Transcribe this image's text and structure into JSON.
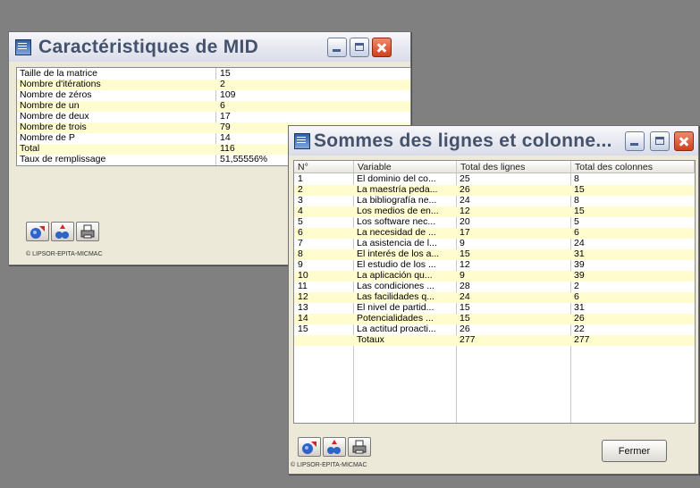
{
  "window1": {
    "title": "Caractéristiques de MID",
    "rows": [
      {
        "label": "Taille de la matrice",
        "value": "15"
      },
      {
        "label": "Nombre d'itérations",
        "value": "2"
      },
      {
        "label": "Nombre de zéros",
        "value": "109"
      },
      {
        "label": "Nombre de un",
        "value": "6"
      },
      {
        "label": "Nombre de deux",
        "value": "17"
      },
      {
        "label": "Nombre de trois",
        "value": "79"
      },
      {
        "label": "Nombre de P",
        "value": "14"
      },
      {
        "label": "Total",
        "value": "116"
      },
      {
        "label": "Taux de remplissage",
        "value": "51,55556%"
      }
    ],
    "copyright": "© LIPSOR-EPITA-MICMAC"
  },
  "window2": {
    "title": "Sommes des lignes et colonne...",
    "columns": [
      "N°",
      "Variable",
      "Total des lignes",
      "Total des colonnes"
    ],
    "rows": [
      {
        "n": "1",
        "variable": "El dominio del co...",
        "lignes": "25",
        "colonnes": "8"
      },
      {
        "n": "2",
        "variable": "La maestría peda...",
        "lignes": "26",
        "colonnes": "15"
      },
      {
        "n": "3",
        "variable": "La bibliografía ne...",
        "lignes": "24",
        "colonnes": "8"
      },
      {
        "n": "4",
        "variable": "Los medios de en...",
        "lignes": "12",
        "colonnes": "15"
      },
      {
        "n": "5",
        "variable": "Los software nec...",
        "lignes": "20",
        "colonnes": "5"
      },
      {
        "n": "6",
        "variable": "La necesidad de ...",
        "lignes": "17",
        "colonnes": "6"
      },
      {
        "n": "7",
        "variable": "La asistencia de l...",
        "lignes": "9",
        "colonnes": "24"
      },
      {
        "n": "8",
        "variable": "El interés de los a...",
        "lignes": "15",
        "colonnes": "31"
      },
      {
        "n": "9",
        "variable": "El estudio de los ...",
        "lignes": "12",
        "colonnes": "39"
      },
      {
        "n": "10",
        "variable": "La aplicación qu...",
        "lignes": "9",
        "colonnes": "39"
      },
      {
        "n": "11",
        "variable": "Las condiciones ...",
        "lignes": "28",
        "colonnes": "2"
      },
      {
        "n": "12",
        "variable": "Las facilidades q...",
        "lignes": "24",
        "colonnes": "6"
      },
      {
        "n": "13",
        "variable": "El nivel de partid...",
        "lignes": "15",
        "colonnes": "31"
      },
      {
        "n": "14",
        "variable": "Potencialidades ...",
        "lignes": "15",
        "colonnes": "26"
      },
      {
        "n": "15",
        "variable": "La actitud proacti...",
        "lignes": "26",
        "colonnes": "22"
      },
      {
        "n": "",
        "variable": "Totaux",
        "lignes": "277",
        "colonnes": "277"
      }
    ],
    "close_label": "Fermer",
    "copyright": "© LIPSOR-EPITA-MICMAC"
  },
  "icons": [
    "window-icon",
    "minimize-icon",
    "maximize-icon",
    "close-icon",
    "export-icon",
    "export-all-icon",
    "print-icon"
  ]
}
